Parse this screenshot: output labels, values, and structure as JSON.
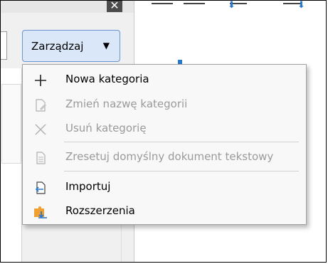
{
  "toolbar": {
    "manage_button_label": "Zarządzaj"
  },
  "menu": {
    "items": [
      {
        "label": "Nowa kategoria",
        "enabled": true,
        "icon": "plus-icon"
      },
      {
        "label": "Zmień nazwę kategorii",
        "enabled": false,
        "icon": "rename-icon"
      },
      {
        "label": "Usuń kategorię",
        "enabled": false,
        "icon": "delete-x-icon"
      },
      {
        "label": "Zresetuj domyślny dokument tekstowy",
        "enabled": false,
        "icon": "document-icon"
      },
      {
        "label": "Importuj",
        "enabled": true,
        "icon": "import-icon"
      },
      {
        "label": "Rozszerzenia",
        "enabled": true,
        "icon": "extensions-icon"
      }
    ]
  },
  "colors": {
    "button_bg": "#d9e7f8",
    "button_border": "#6a95d0",
    "menu_bg": "#f8f8f8",
    "disabled_text": "#9a9a9a",
    "accent_blue": "#2a78c9",
    "accent_orange": "#f0a030"
  }
}
